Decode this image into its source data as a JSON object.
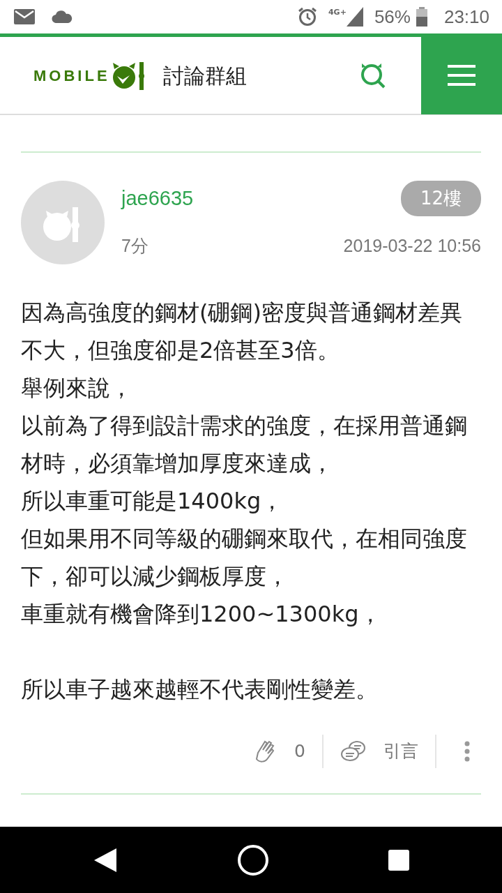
{
  "status_bar": {
    "network": "4G+",
    "battery": "56%",
    "time": "23:10"
  },
  "header": {
    "logo_text": "MOBILE",
    "title": "討論群組"
  },
  "post": {
    "username": "jae6635",
    "floor": "12樓",
    "age": "7分",
    "date": "2019-03-22 10:56",
    "body": [
      [
        "因為高強度的鋼材(硼鋼)密度與普通鋼材差異不大，但強度卻是2倍甚至3倍。",
        "舉例來說，",
        "以前為了得到設計需求的強度，在採用普通鋼材時，必須靠增加厚度來達成，",
        "所以車重可能是1400kg，",
        "但如果用不同等級的硼鋼來取代，在相同強度下，卻可以減少鋼板厚度，",
        "車重就有機會降到1200~1300kg，"
      ],
      [
        "所以車子越來越輕不代表剛性變差。"
      ]
    ],
    "likes": "0",
    "quote": "引言"
  }
}
